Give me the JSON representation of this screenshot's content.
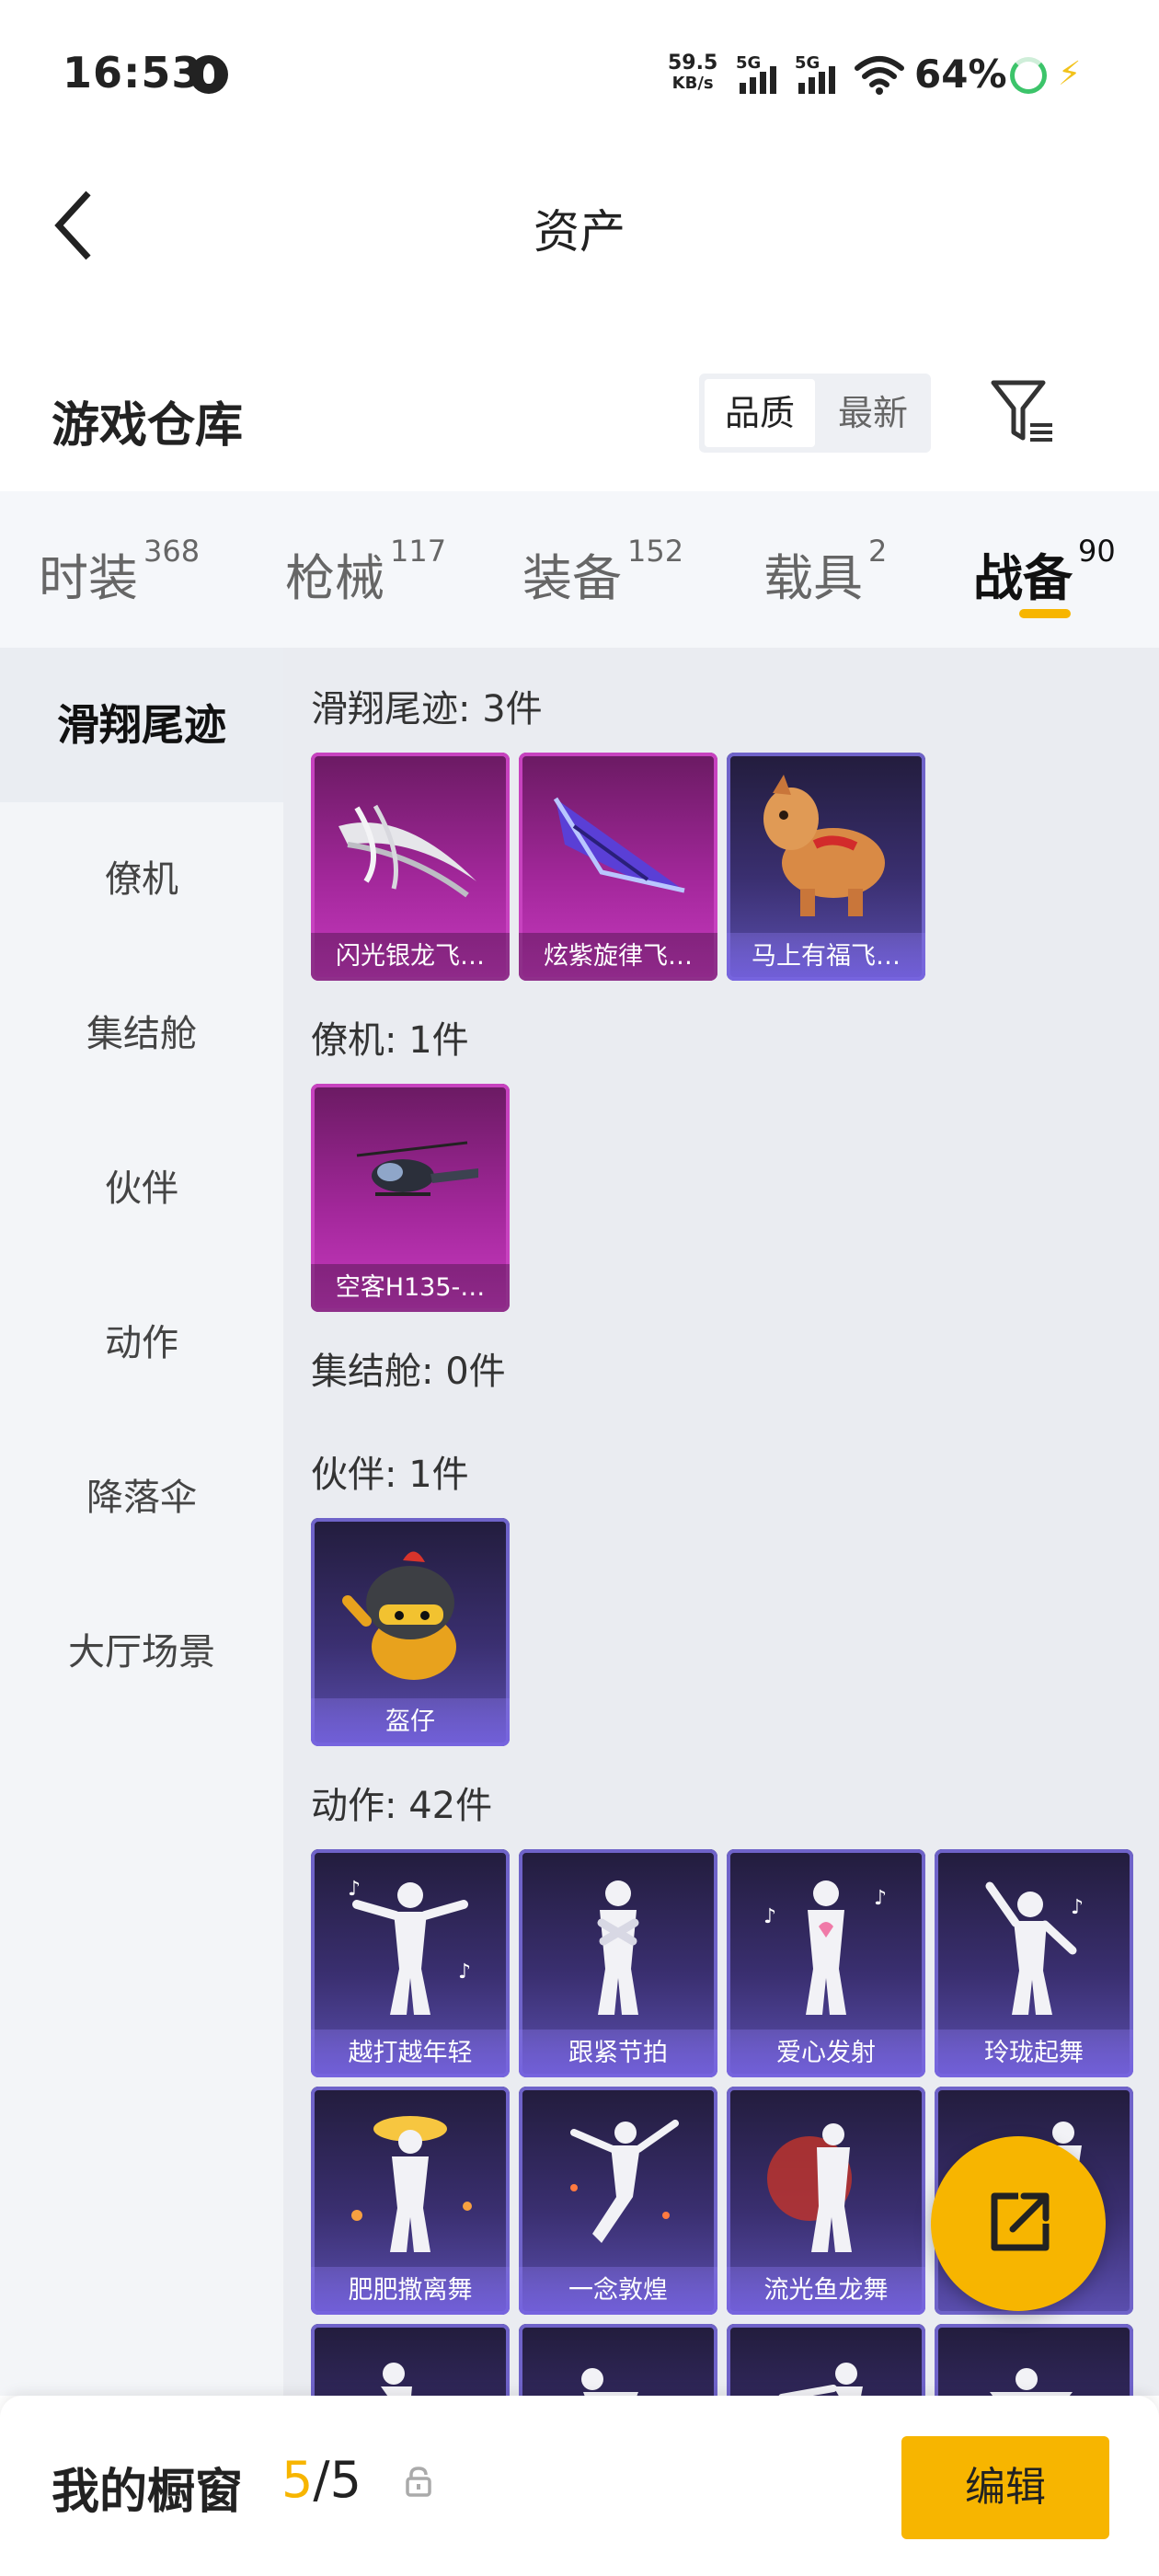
{
  "status_bar": {
    "time": "16:53",
    "net_speed_value": "59.5",
    "net_speed_unit": "KB/s",
    "sim1": "5G",
    "sim2": "5G",
    "battery": "64%"
  },
  "header": {
    "title": "资产"
  },
  "warehouse": {
    "title": "游戏仓库",
    "sort_options": [
      "品质",
      "最新"
    ],
    "sort_selected": "品质"
  },
  "tabs": [
    {
      "label": "时装",
      "count": "368"
    },
    {
      "label": "枪械",
      "count": "117"
    },
    {
      "label": "装备",
      "count": "152"
    },
    {
      "label": "载具",
      "count": "2"
    },
    {
      "label": "战备",
      "count": "90"
    }
  ],
  "active_tab": "战备",
  "sidebar": {
    "items": [
      "滑翔尾迹",
      "僚机",
      "集结舱",
      "伙伴",
      "动作",
      "降落伞",
      "大厅场景"
    ],
    "active": "滑翔尾迹"
  },
  "sections": [
    {
      "label": "滑翔尾迹: 3件",
      "items": [
        {
          "name": "闪光银龙飞…",
          "rarity": "purple"
        },
        {
          "name": "炫紫旋律飞…",
          "rarity": "purple"
        },
        {
          "name": "马上有福飞…",
          "rarity": "blue"
        }
      ]
    },
    {
      "label": "僚机: 1件",
      "items": [
        {
          "name": "空客H135-…",
          "rarity": "purple"
        }
      ]
    },
    {
      "label": "集结舱: 0件",
      "items": []
    },
    {
      "label": "伙伴: 1件",
      "items": [
        {
          "name": "盔仔",
          "rarity": "blue"
        }
      ]
    },
    {
      "label": "动作: 42件",
      "items": [
        {
          "name": "越打越年轻",
          "rarity": "blue"
        },
        {
          "name": "跟紧节拍",
          "rarity": "blue"
        },
        {
          "name": "爱心发射",
          "rarity": "blue"
        },
        {
          "name": "玲珑起舞",
          "rarity": "blue"
        },
        {
          "name": "肥肥撒离舞",
          "rarity": "blue"
        },
        {
          "name": "一念敦煌",
          "rarity": "blue"
        },
        {
          "name": "流光鱼龙舞",
          "rarity": "blue"
        }
      ]
    }
  ],
  "showcase": {
    "label": "我的橱窗",
    "current": "5",
    "separator": "/",
    "total": "5",
    "edit_label": "编辑"
  },
  "colors": {
    "accent": "#f7b500",
    "purple_rarity": "#b02aa8",
    "blue_rarity": "#3a2f70"
  }
}
